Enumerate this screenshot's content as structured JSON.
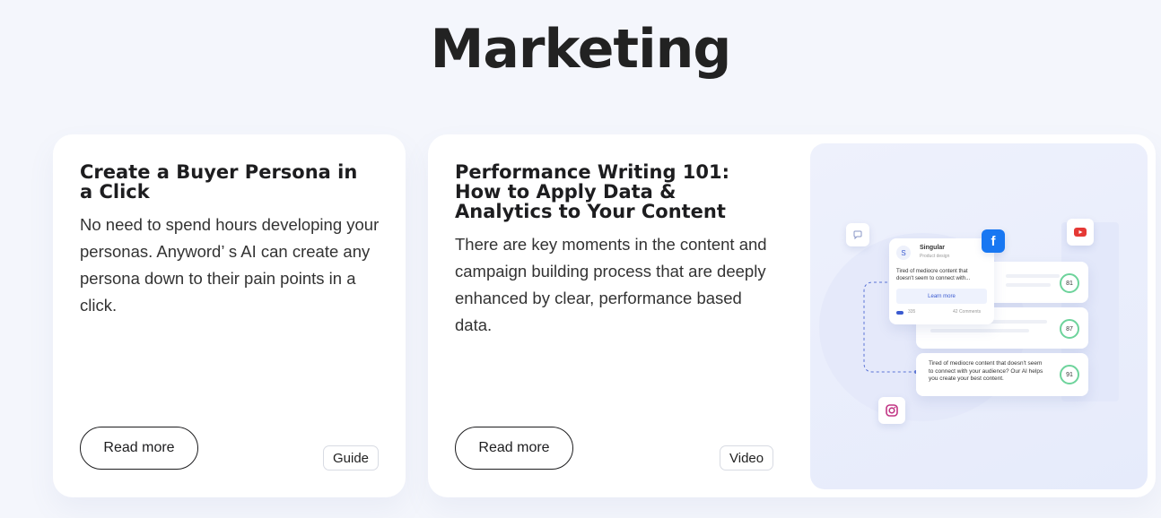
{
  "page": {
    "title": "Marketing"
  },
  "cards": [
    {
      "title": "Create a Buyer Persona in a Click",
      "description": "No need to spend hours developing your personas. Anyword’ s AI can create any persona down to their pain points in a click.",
      "button_label": "Read more",
      "tag": "Guide"
    },
    {
      "title": "Performance Writing 101: How to Apply Data & Analytics to Your Content",
      "description": "There are key moments in the content and campaign building process that are deeply enhanced by clear, performance based data.",
      "button_label": "Read more",
      "tag": "Video"
    }
  ],
  "illustration": {
    "profile_initial": "S",
    "profile_name": "Singular",
    "profile_sub": "Product design",
    "post_text": "Tired of mediocre content that doesn't seem to connect with...",
    "learn_more": "Learn more",
    "likes": "335",
    "comments": "42 Comments",
    "scores": [
      "81",
      "87",
      "91"
    ],
    "bottom_text": "Tired of mediocre content that doesn't seem to connect with your audience? Our AI helps you create your best content.",
    "icons": [
      "chat-icon",
      "facebook-icon",
      "youtube-icon",
      "instagram-icon"
    ],
    "accent_green": "#6dd39b",
    "facebook_blue": "#1877f2",
    "youtube_red": "#e53935"
  }
}
